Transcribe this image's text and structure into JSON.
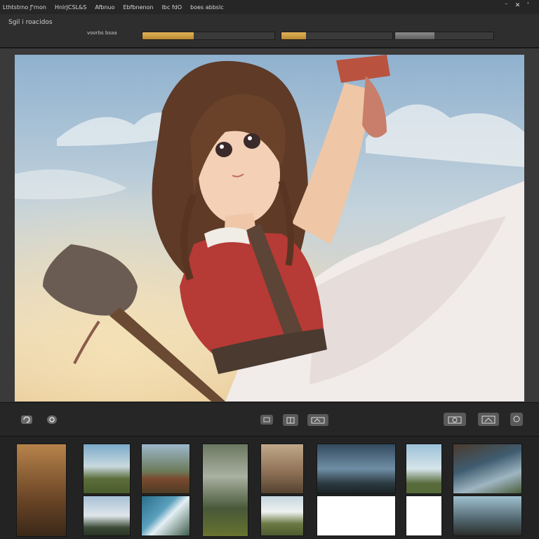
{
  "menubar": {
    "items": [
      "Lthtstrno ƒ'rnon",
      "HnlrJCSL&S",
      "Afbnuo",
      "Ebfbnenon",
      "Ibc fdO",
      "boes abbslc"
    ],
    "window_controls": [
      "⁻",
      "✕",
      "ʾ"
    ]
  },
  "toolbar": {
    "doc_title": "Sgil i roacidos",
    "slider_label": "voorbs bsaa",
    "sliders": [
      0.39,
      0.22,
      0.4
    ]
  },
  "colors": {
    "accent": "#d9a84c",
    "panel": "#2b2b2b",
    "menubar": "#262626"
  },
  "canvas": {
    "description_icon": "painting-canvas"
  },
  "controls": {
    "left": [
      "rotate-icon",
      "settings-icon"
    ],
    "center": [
      "crop-icon",
      "fit-icon",
      "compare-icon"
    ],
    "right": [
      "camera-icon",
      "export-icon",
      "zoom-icon"
    ]
  },
  "filmstrip": {
    "icon": "film-icon",
    "count": 14
  }
}
